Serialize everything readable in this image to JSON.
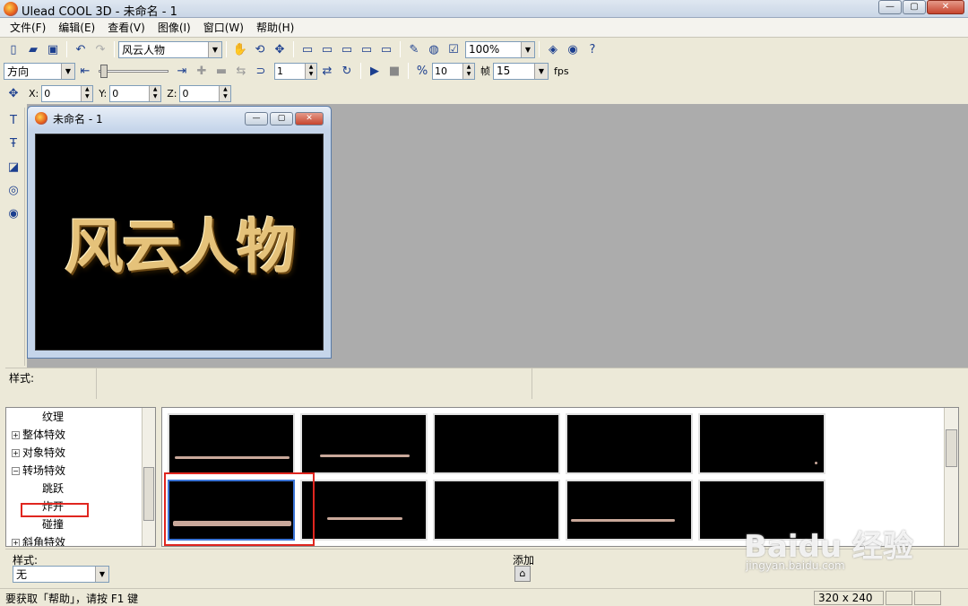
{
  "window": {
    "title": "Ulead COOL 3D - 未命名 - 1"
  },
  "menu": [
    "文件(F)",
    "编辑(E)",
    "查看(V)",
    "图像(I)",
    "窗口(W)",
    "帮助(H)"
  ],
  "toolbar1": {
    "text_combo": "风云人物",
    "zoom_combo": "100%"
  },
  "toolbar2": {
    "direction_combo": "方向",
    "step_value": "1",
    "frames_value": "10",
    "frames_label": "帧",
    "fps_value": "15",
    "fps_label": "fps"
  },
  "toolbar3": {
    "x_label": "X:",
    "x_value": "0",
    "y_label": "Y:",
    "y_value": "0",
    "z_label": "Z:",
    "z_value": "0"
  },
  "child": {
    "title": "未命名 - 1",
    "canvas_text": "风云人物"
  },
  "stylebar": {
    "label": "样式:"
  },
  "tree": {
    "items": [
      "纹理",
      "整体特效",
      "对象特效",
      "转场特效",
      "跳跃",
      "炸开",
      "碰撞",
      "斜角特效"
    ]
  },
  "bottom": {
    "style_label": "样式:",
    "style_value": "无",
    "add_label": "添加"
  },
  "status": {
    "text": "要获取「帮助」，请按 F1 键",
    "size": "320 x 240"
  },
  "watermark": {
    "brand": "Baidu 经验",
    "url": "jingyan.baidu.com"
  },
  "colors": {
    "highlight": "#e0261f",
    "selection": "#3a74d6",
    "workspace": "#acacac"
  }
}
